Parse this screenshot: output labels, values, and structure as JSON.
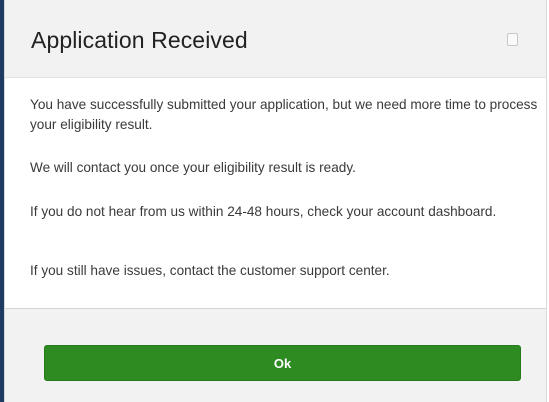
{
  "dialog": {
    "title": "Application Received",
    "close_icon": "checkbox-square-icon",
    "messages": [
      "You have successfully submitted your application, but we need more time to process your eligibility result.",
      "We will contact you once your eligibility result is ready.",
      "If you do not hear from us within 24-48 hours, check your account dashboard.",
      "If you still have issues, contact the customer support center."
    ],
    "ok_label": "Ok"
  },
  "colors": {
    "header_bg": "#f2f2f2",
    "button_green": "#2e8b22",
    "left_edge": "#1f3b63"
  }
}
